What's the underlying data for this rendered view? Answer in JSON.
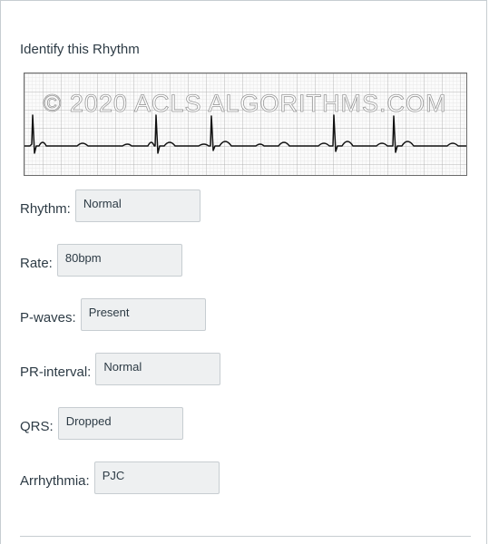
{
  "question": {
    "title": "Identify this Rhythm",
    "image_watermark": "© 2020 ACLS ALGORITHMS.COM"
  },
  "fields": [
    {
      "label": "Rhythm:",
      "value": "Normal"
    },
    {
      "label": "Rate:",
      "value": "80bpm"
    },
    {
      "label": "P-waves:",
      "value": "Present"
    },
    {
      "label": "PR-interval:",
      "value": "Normal"
    },
    {
      "label": "QRS:",
      "value": "Dropped"
    },
    {
      "label": "Arrhythmia:",
      "value": "PJC"
    }
  ],
  "colors": {
    "text": "#2d3b45",
    "field_bg": "#eef0f1",
    "border": "#c7cdd1",
    "grid": "#cfcfcf",
    "trace": "#111111"
  }
}
